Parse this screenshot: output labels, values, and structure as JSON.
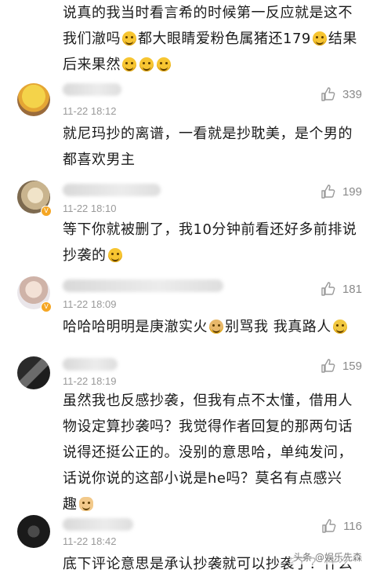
{
  "top_comment": {
    "lines": [
      "说真的我当时看言希的时候第一反应就是这不",
      "我们澈吗",
      "都大眼睛爱粉色属猪还179",
      "结果",
      "后来果然"
    ]
  },
  "comments": [
    {
      "time": "11-22 18:12",
      "likes": "339",
      "text": [
        "就尼玛抄的离谱，一看就是抄耽美，是个男的",
        "都喜欢男主"
      ]
    },
    {
      "time": "11-22 18:10",
      "likes": "199",
      "text": [
        "等下你就被删了，我10分钟前看还好多前排说",
        "抄袭的"
      ]
    },
    {
      "time": "11-22 18:09",
      "likes": "181",
      "text": [
        "哈哈哈明明是庚澈实火",
        "别骂我 我真路人"
      ]
    },
    {
      "time": "11-22 18:19",
      "likes": "159",
      "text": [
        "虽然我也反感抄袭，但我有点不太懂，借用人",
        "物设定算抄袭吗？我觉得作者回复的那两句话",
        "说得还挺公正的。没别的意思哈，单纯发问，",
        "话说你说的这部小说是he吗？莫名有点感兴",
        "趣"
      ]
    },
    {
      "time": "11-22 18:42",
      "likes": "116",
      "text": [
        "底下评论意思是承认抄袭就可以抄袭了？什么"
      ]
    }
  ],
  "watermark": "头条 @娱乐先森"
}
